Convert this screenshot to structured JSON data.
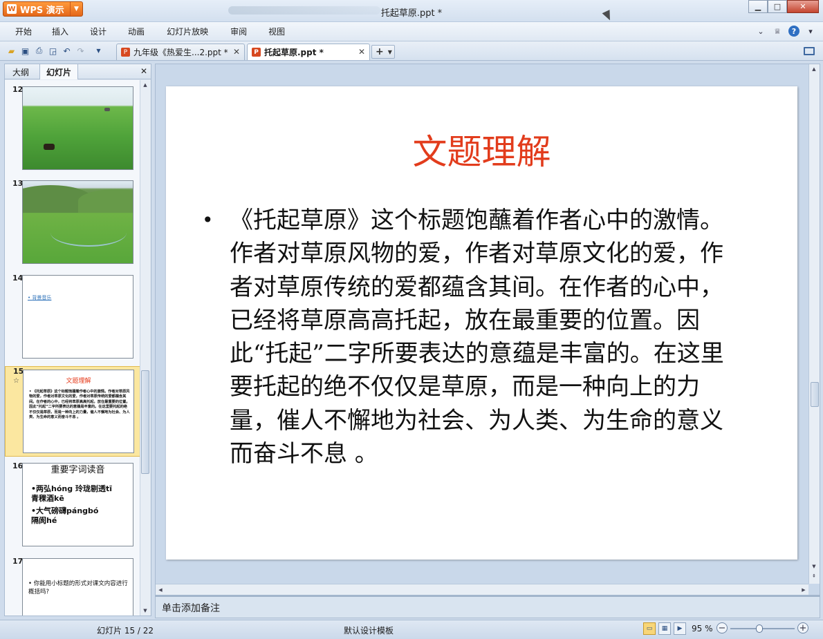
{
  "app": {
    "button_label": "WPS 演示",
    "window_title": "托起草原.ppt *"
  },
  "menu": {
    "items": [
      "开始",
      "插入",
      "设计",
      "动画",
      "幻灯片放映",
      "审阅",
      "视图"
    ]
  },
  "tabs": [
    {
      "label": "九年级《热爱生...2.ppt *",
      "active": false
    },
    {
      "label": "托起草原.ppt *",
      "active": true
    }
  ],
  "left_panel": {
    "tabs": [
      "大纲",
      "幻灯片"
    ],
    "active_tab": "幻灯片",
    "thumbnails": [
      {
        "number": "12",
        "kind": "image"
      },
      {
        "number": "13",
        "kind": "image"
      },
      {
        "number": "14",
        "text": "背景音乐"
      },
      {
        "number": "15",
        "selected": true,
        "title": "文题理解",
        "body": "• 《托起草原》这个标题饱蘸着作者心中的激情。作者对草原风物的爱，作者对草原文化的爱，作者对草原传统的爱都蕴含其间。在作者的心中，已经将草原高高托起，放在最重要的位置。因此“托起”二字所要表达的意蕴是丰富的。在这里要托起的绝不仅仅是草原，而是一种向上的力量，催人不懈地为社会、为人类、为生命的意义而奋斗不息 。"
      },
      {
        "number": "16",
        "title": "重要字词读音",
        "lines": [
          "•两弘hóng 玲珑剔透tī",
          "青稞酒kē",
          "•大气磅礴pángbó",
          "隔阂hé"
        ]
      },
      {
        "number": "17",
        "text": "• 你能用小标题的形式对课文内容进行概括吗?"
      }
    ]
  },
  "slide": {
    "title": "文题理解",
    "bullet": "•",
    "body": "《托起草原》这个标题饱蘸着作者心中的激情。作者对草原风物的爱，作者对草原文化的爱，作者对草原传统的爱都蕴含其间。在作者的心中，已经将草原高高托起，放在最重要的位置。因此“托起”二字所要表达的意蕴是丰富的。在这里要托起的绝不仅仅是草原，而是一种向上的力量，催人不懈地为社会、为人类、为生命的意义而奋斗不息 。",
    "title_color": "#e23c1c"
  },
  "notes": {
    "placeholder": "单击添加备注"
  },
  "status": {
    "slide_indicator": "幻灯片 15 / 22",
    "template": "默认设计模板",
    "zoom": "95 %",
    "zoom_level": 0.45
  },
  "colors": {
    "accent": "#e4671a",
    "selection": "#fbe7a0"
  }
}
